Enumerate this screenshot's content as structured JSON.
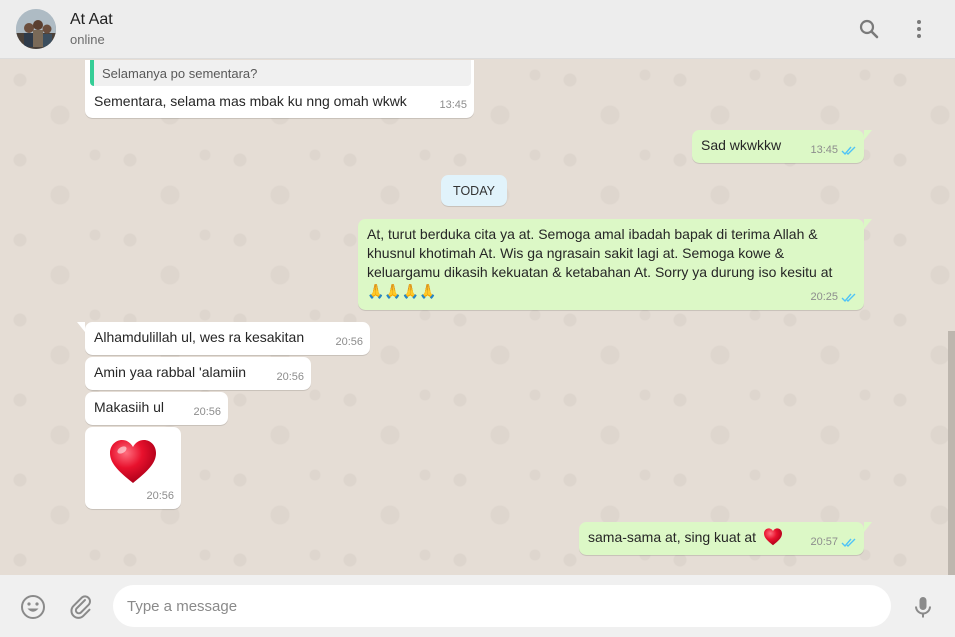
{
  "header": {
    "contact_name": "At Aat",
    "status": "online"
  },
  "date_divider": "TODAY",
  "messages": [
    {
      "direction": "in",
      "quoted_text": "Selamanya po sementara?",
      "text": "Sementara, selama mas mbak ku nng omah wkwk",
      "time": "13:45"
    },
    {
      "direction": "out",
      "text": "Sad wkwkkw",
      "time": "13:45",
      "read": true
    },
    {
      "direction": "out",
      "text": "At, turut berduka cita ya at. Semoga amal ibadah bapak di terima Allah & khusnul khotimah At. Wis ga ngrasain sakit lagi at. Semoga kowe & keluargamu dikasih kekuatan & ketabahan At. Sorry ya durung iso kesitu at 🙏🙏🙏🙏",
      "time": "20:25",
      "read": true
    },
    {
      "direction": "in",
      "text": "Alhamdulillah ul, wes ra kesakitan",
      "time": "20:56"
    },
    {
      "direction": "in",
      "text": "Amin yaa rabbal 'alamiin",
      "time": "20:56"
    },
    {
      "direction": "in",
      "text": "Makasiih ul",
      "time": "20:56"
    },
    {
      "direction": "in",
      "emoji": "heart",
      "time": "20:56"
    },
    {
      "direction": "out",
      "text": "sama-sama at, sing kuat at",
      "emoji": "heart",
      "time": "20:57",
      "read": true
    }
  ],
  "composer": {
    "placeholder": "Type a message"
  },
  "colors": {
    "header_bg": "#ededed",
    "chat_bg": "#e5ddd5",
    "outgoing_bubble": "#dcf8c6",
    "incoming_bubble": "#ffffff",
    "read_tick": "#4fc3f7",
    "date_pill": "#e1f3fb",
    "heart": "#e8112d"
  },
  "icons": {
    "header": [
      "search-icon",
      "menu-icon"
    ],
    "footer": [
      "smiley-icon",
      "paperclip-icon",
      "microphone-icon"
    ]
  }
}
